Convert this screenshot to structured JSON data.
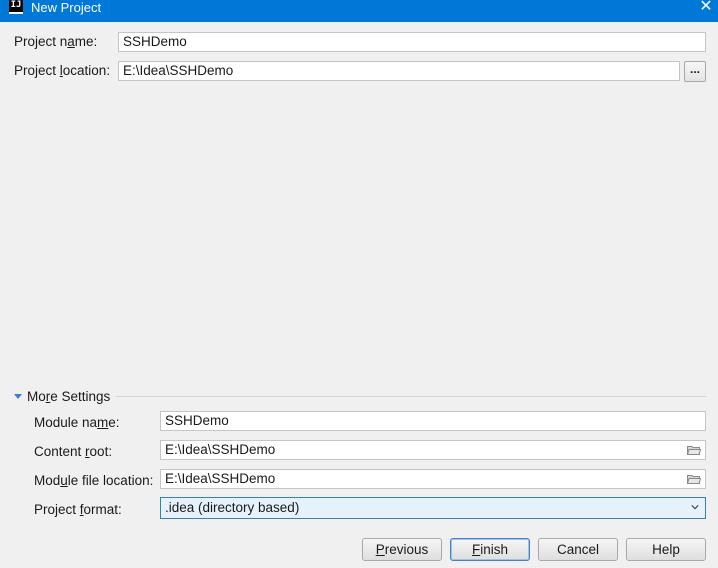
{
  "window": {
    "title": "New Project",
    "app_icon_text": "IJ",
    "close_glyph": "✕"
  },
  "project": {
    "name_label_pre": "Project n",
    "name_label_mnemonic": "a",
    "name_label_post": "me:",
    "name_value": "SSHDemo",
    "location_label_pre": "Project ",
    "location_label_mnemonic": "l",
    "location_label_post": "ocation:",
    "location_value": "E:\\Idea\\SSHDemo",
    "browse_label": "..."
  },
  "more_settings": {
    "label_pre": "Mo",
    "label_mnemonic": "r",
    "label_post": "e Settings",
    "module_name_label_pre": "Module na",
    "module_name_label_mnemonic": "m",
    "module_name_label_post": "e:",
    "module_name_value": "SSHDemo",
    "content_root_label_pre": "Content ",
    "content_root_label_mnemonic": "r",
    "content_root_label_post": "oot:",
    "content_root_value": "E:\\Idea\\SSHDemo",
    "module_file_label_pre": "Mod",
    "module_file_label_mnemonic": "u",
    "module_file_label_post": "le file location:",
    "module_file_value": "E:\\Idea\\SSHDemo",
    "format_label_pre": "Project ",
    "format_label_mnemonic": "f",
    "format_label_post": "ormat:",
    "format_value": ".idea (directory based)"
  },
  "buttons": {
    "previous_mnemonic": "P",
    "previous_rest": "revious",
    "finish_mnemonic": "F",
    "finish_rest": "inish",
    "cancel": "Cancel",
    "help": "Help"
  },
  "colors": {
    "titlebar": "#0078d7",
    "accent": "#3c7bd6",
    "dialog_bg": "#f0f0f0"
  }
}
